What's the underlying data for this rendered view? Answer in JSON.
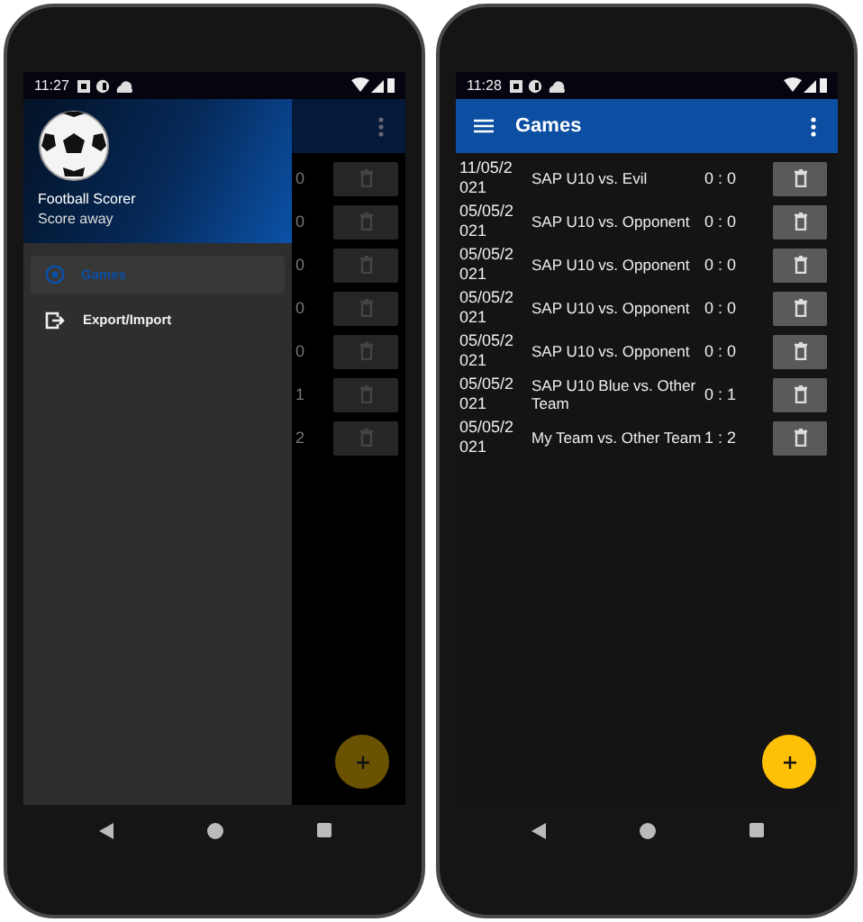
{
  "phones": [
    {
      "kind": "drawer_open",
      "status_bar": {
        "time": "11:27"
      },
      "drawer": {
        "title": "Football Scorer",
        "subtitle": "Score away",
        "items": [
          {
            "label": "Games",
            "kind": "games",
            "selected": true
          },
          {
            "label": "Export/Import",
            "kind": "transfer",
            "selected": false
          }
        ]
      },
      "games": [
        {
          "score": "0"
        },
        {
          "score": "0"
        },
        {
          "score": "0"
        },
        {
          "score": "0"
        },
        {
          "score": "0"
        },
        {
          "score": "1"
        },
        {
          "score": "2"
        }
      ]
    },
    {
      "kind": "list",
      "status_bar": {
        "time": "11:28"
      },
      "app_bar": {
        "title": "Games"
      },
      "games": [
        {
          "date": "11/05/2021",
          "name": "SAP U10 vs. Evil",
          "score": "0 : 0"
        },
        {
          "date": "05/05/2021",
          "name": "SAP U10 vs. Opponent",
          "score": "0 : 0"
        },
        {
          "date": "05/05/2021",
          "name": "SAP U10 vs. Opponent",
          "score": "0 : 0"
        },
        {
          "date": "05/05/2021",
          "name": "SAP U10 vs. Opponent",
          "score": "0 : 0"
        },
        {
          "date": "05/05/2021",
          "name": "SAP U10 vs. Opponent",
          "score": "0 : 0"
        },
        {
          "date": "05/05/2021",
          "name": "SAP U10 Blue vs. Other Team",
          "score": "0 : 1"
        },
        {
          "date": "05/05/2021",
          "name": "My Team vs. Other Team",
          "score": "1 : 2"
        }
      ]
    }
  ]
}
